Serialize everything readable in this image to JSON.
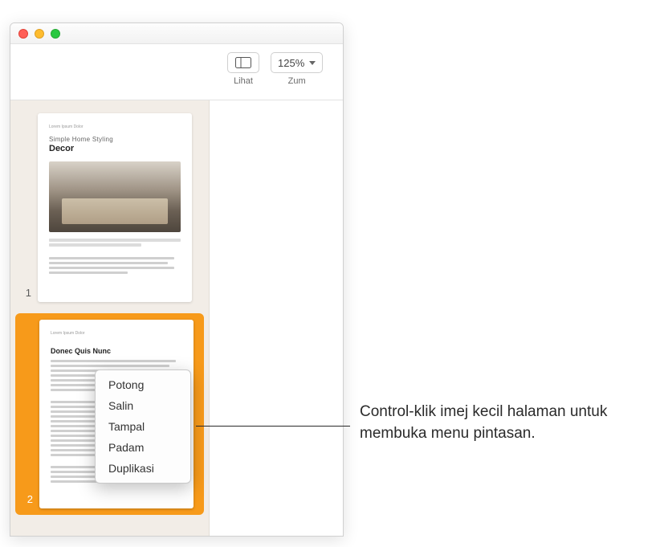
{
  "toolbar": {
    "view_label": "Lihat",
    "zoom_value": "125%",
    "zoom_label": "Zum"
  },
  "thumbnails": {
    "page1": {
      "number": "1",
      "header": "Lorem Ipsum Dolor",
      "subtitle": "Simple Home Styling",
      "title": "Decor"
    },
    "page2": {
      "number": "2",
      "header": "Lorem Ipsum Dolor",
      "heading": "Donec Quis Nunc"
    }
  },
  "context_menu": {
    "items": [
      "Potong",
      "Salin",
      "Tampal",
      "Padam",
      "Duplikasi"
    ]
  },
  "callout": {
    "text": "Control-klik imej kecil halaman untuk membuka menu pintasan."
  }
}
